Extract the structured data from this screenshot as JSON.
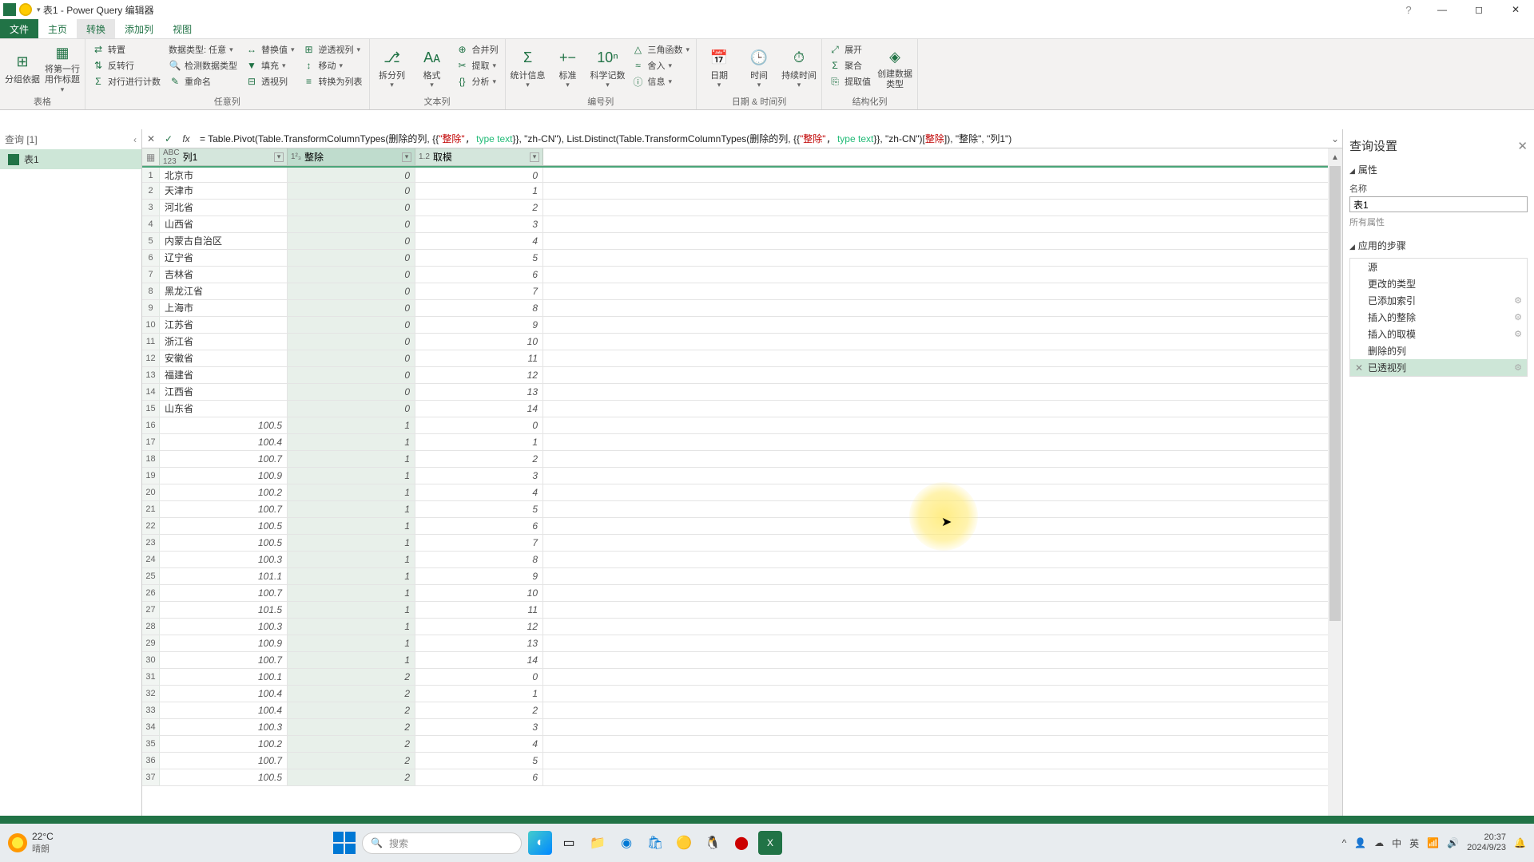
{
  "window": {
    "title": "表1 - Power Query 编辑器"
  },
  "menu": {
    "file": "文件",
    "home": "主页",
    "transform": "转换",
    "add_column": "添加列",
    "view": "视图"
  },
  "ribbon": {
    "group1": {
      "btn1": "分组依据",
      "btn2": "将第一行用作标题",
      "label": "表格"
    },
    "group2": {
      "r1a": "转置",
      "r1b": "数据类型: 任意",
      "r1c": "替换值",
      "r1d": "逆透视列",
      "r2a": "反转行",
      "r2b": "检测数据类型",
      "r2c": "填充",
      "r2d": "移动",
      "r3a": "对行进行计数",
      "r3b": "重命名",
      "r3c": "透视列",
      "r3d": "转换为列表",
      "label": "任意列"
    },
    "group3": {
      "b1": "拆分列",
      "b2": "格式",
      "s1": "合并列",
      "s2": "提取",
      "s3": "分析",
      "label": "文本列"
    },
    "group4": {
      "b1": "统计信息",
      "b2": "标准",
      "b3": "科学记数",
      "s1": "三角函数",
      "s2": "舍入",
      "s3": "信息",
      "label": "编号列"
    },
    "group5": {
      "b1": "日期",
      "b2": "时间",
      "b3": "持续时间",
      "label": "日期 & 时间列"
    },
    "group6": {
      "s1": "展开",
      "s2": "聚合",
      "s3": "提取值",
      "b1": "创建数据类型",
      "label": "结构化列"
    }
  },
  "formula": {
    "prefix": "= Table.Pivot(Table.TransformColumnTypes(删除的列, {{",
    "k1": "\"整除\"",
    "t1": "type text",
    "mid1": "}}, \"zh-CN\"), List.Distinct(Table.TransformColumnTypes(删除的列, {{",
    "k2": "\"整除\"",
    "t2": "type text",
    "mid2": "}}, \"zh-CN\")[",
    "k3": "整除",
    "end": "]), \"整除\", \"列1\")"
  },
  "queries": {
    "header": "查询 [1]",
    "item1": "表1"
  },
  "columns": {
    "c1": "列1",
    "c2": "整除",
    "c3": "取模",
    "type1": "ABC\n123",
    "type2": "1²₃",
    "type3": "1.2"
  },
  "rows": [
    {
      "n": 1,
      "c1": "北京市",
      "c2": "0",
      "c3": "0"
    },
    {
      "n": 2,
      "c1": "天津市",
      "c2": "0",
      "c3": "1"
    },
    {
      "n": 3,
      "c1": "河北省",
      "c2": "0",
      "c3": "2"
    },
    {
      "n": 4,
      "c1": "山西省",
      "c2": "0",
      "c3": "3"
    },
    {
      "n": 5,
      "c1": "内蒙古自治区",
      "c2": "0",
      "c3": "4"
    },
    {
      "n": 6,
      "c1": "辽宁省",
      "c2": "0",
      "c3": "5"
    },
    {
      "n": 7,
      "c1": "吉林省",
      "c2": "0",
      "c3": "6"
    },
    {
      "n": 8,
      "c1": "黑龙江省",
      "c2": "0",
      "c3": "7"
    },
    {
      "n": 9,
      "c1": "上海市",
      "c2": "0",
      "c3": "8"
    },
    {
      "n": 10,
      "c1": "江苏省",
      "c2": "0",
      "c3": "9"
    },
    {
      "n": 11,
      "c1": "浙江省",
      "c2": "0",
      "c3": "10"
    },
    {
      "n": 12,
      "c1": "安徽省",
      "c2": "0",
      "c3": "11"
    },
    {
      "n": 13,
      "c1": "福建省",
      "c2": "0",
      "c3": "12"
    },
    {
      "n": 14,
      "c1": "江西省",
      "c2": "0",
      "c3": "13"
    },
    {
      "n": 15,
      "c1": "山东省",
      "c2": "0",
      "c3": "14"
    },
    {
      "n": 16,
      "c1": "100.5",
      "c2": "1",
      "c3": "0"
    },
    {
      "n": 17,
      "c1": "100.4",
      "c2": "1",
      "c3": "1"
    },
    {
      "n": 18,
      "c1": "100.7",
      "c2": "1",
      "c3": "2"
    },
    {
      "n": 19,
      "c1": "100.9",
      "c2": "1",
      "c3": "3"
    },
    {
      "n": 20,
      "c1": "100.2",
      "c2": "1",
      "c3": "4"
    },
    {
      "n": 21,
      "c1": "100.7",
      "c2": "1",
      "c3": "5"
    },
    {
      "n": 22,
      "c1": "100.5",
      "c2": "1",
      "c3": "6"
    },
    {
      "n": 23,
      "c1": "100.5",
      "c2": "1",
      "c3": "7"
    },
    {
      "n": 24,
      "c1": "100.3",
      "c2": "1",
      "c3": "8"
    },
    {
      "n": 25,
      "c1": "101.1",
      "c2": "1",
      "c3": "9"
    },
    {
      "n": 26,
      "c1": "100.7",
      "c2": "1",
      "c3": "10"
    },
    {
      "n": 27,
      "c1": "101.5",
      "c2": "1",
      "c3": "11"
    },
    {
      "n": 28,
      "c1": "100.3",
      "c2": "1",
      "c3": "12"
    },
    {
      "n": 29,
      "c1": "100.9",
      "c2": "1",
      "c3": "13"
    },
    {
      "n": 30,
      "c1": "100.7",
      "c2": "1",
      "c3": "14"
    },
    {
      "n": 31,
      "c1": "100.1",
      "c2": "2",
      "c3": "0"
    },
    {
      "n": 32,
      "c1": "100.4",
      "c2": "2",
      "c3": "1"
    },
    {
      "n": 33,
      "c1": "100.4",
      "c2": "2",
      "c3": "2"
    },
    {
      "n": 34,
      "c1": "100.3",
      "c2": "2",
      "c3": "3"
    },
    {
      "n": 35,
      "c1": "100.2",
      "c2": "2",
      "c3": "4"
    },
    {
      "n": 36,
      "c1": "100.7",
      "c2": "2",
      "c3": "5"
    },
    {
      "n": 37,
      "c1": "100.5",
      "c2": "2",
      "c3": "6"
    }
  ],
  "settings": {
    "title": "查询设置",
    "properties": "属性",
    "name_label": "名称",
    "name_value": "表1",
    "all_props": "所有属性",
    "steps_header": "应用的步骤",
    "steps": [
      "源",
      "更改的类型",
      "已添加索引",
      "插入的整除",
      "插入的取模",
      "删除的列",
      "已透视列"
    ]
  },
  "taskbar": {
    "temp": "22°C",
    "weather": "晴朗",
    "search_placeholder": "搜索",
    "ime": "中",
    "lang": "英",
    "time": "20:37",
    "date": "2024/9/23"
  }
}
